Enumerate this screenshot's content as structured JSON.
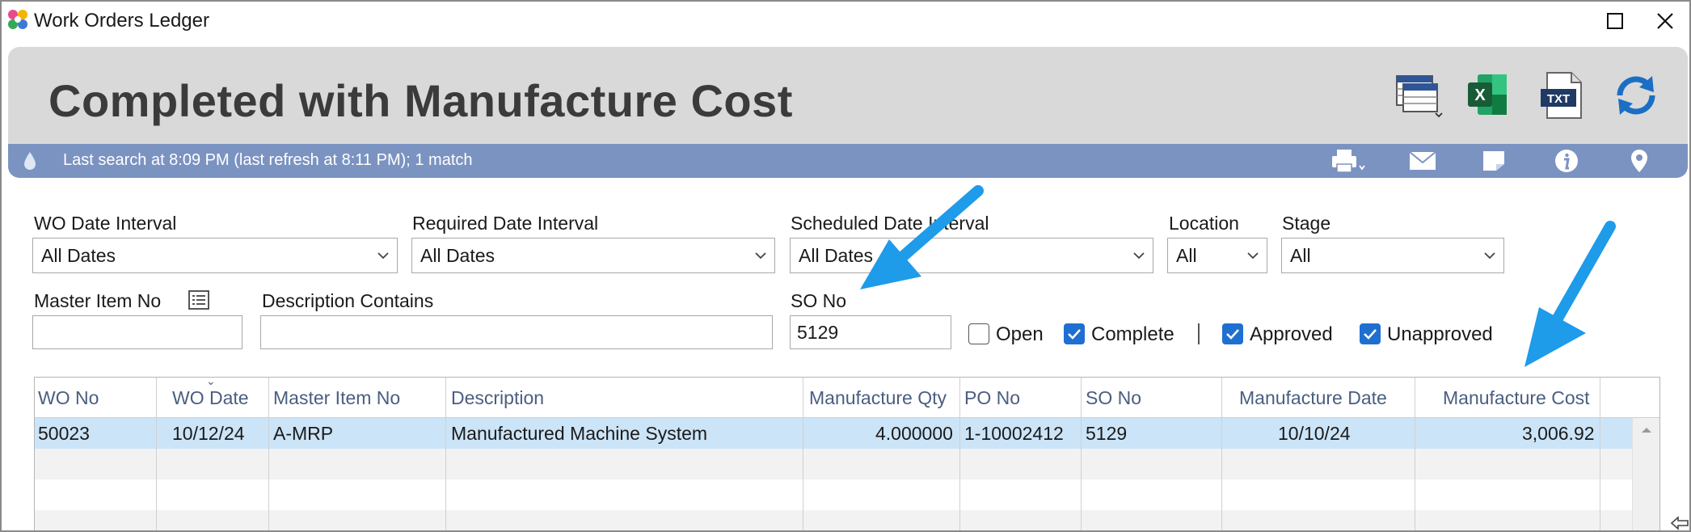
{
  "window": {
    "title": "Work Orders Ledger"
  },
  "header": {
    "title": "Completed with Manufacture Cost",
    "icons": [
      "grid-layout-icon",
      "excel-icon",
      "txt-export-icon",
      "refresh-icon"
    ],
    "txt_badge": "TXT",
    "excel_badge": "X"
  },
  "status": {
    "text": "Last search at 8:09 PM (last refresh at 8:11 PM); 1 match",
    "icons": [
      "drop-icon",
      "print-icon",
      "mail-icon",
      "note-icon",
      "info-icon",
      "location-pin-icon"
    ]
  },
  "filters": {
    "wo_date_interval": {
      "label": "WO Date Interval",
      "value": "All Dates"
    },
    "required_date_interval": {
      "label": "Required Date Interval",
      "value": "All Dates"
    },
    "scheduled_date_interval": {
      "label": "Scheduled Date Interval",
      "value": "All Dates"
    },
    "location": {
      "label": "Location",
      "value": "All"
    },
    "stage": {
      "label": "Stage",
      "value": "All"
    },
    "master_item_no": {
      "label": "Master Item No",
      "value": ""
    },
    "description_contains": {
      "label": "Description Contains",
      "value": ""
    },
    "so_no": {
      "label": "SO No",
      "value": "5129"
    },
    "checkboxes": [
      {
        "label": "Open",
        "checked": false
      },
      {
        "label": "Complete",
        "checked": true
      },
      {
        "label": "Approved",
        "checked": true
      },
      {
        "label": "Unapproved",
        "checked": true
      }
    ]
  },
  "grid": {
    "columns": [
      "WO No",
      "WO Date",
      "Master Item No",
      "Description",
      "Manufacture Qty",
      "PO No",
      "SO No",
      "Manufacture Date",
      "Manufacture Cost"
    ],
    "rows": [
      [
        "50023",
        "10/12/24",
        "A-MRP",
        "Manufactured Machine System",
        "4.000000",
        "1-10002412",
        "5129",
        "10/10/24",
        "3,006.92"
      ]
    ]
  },
  "colors": {
    "accent": "#1f6fd1",
    "status_bar": "#7b93c1",
    "header_bg": "#d9d9d9",
    "selected_row": "#cce4f7",
    "annotation_arrow": "#1e9be9"
  }
}
